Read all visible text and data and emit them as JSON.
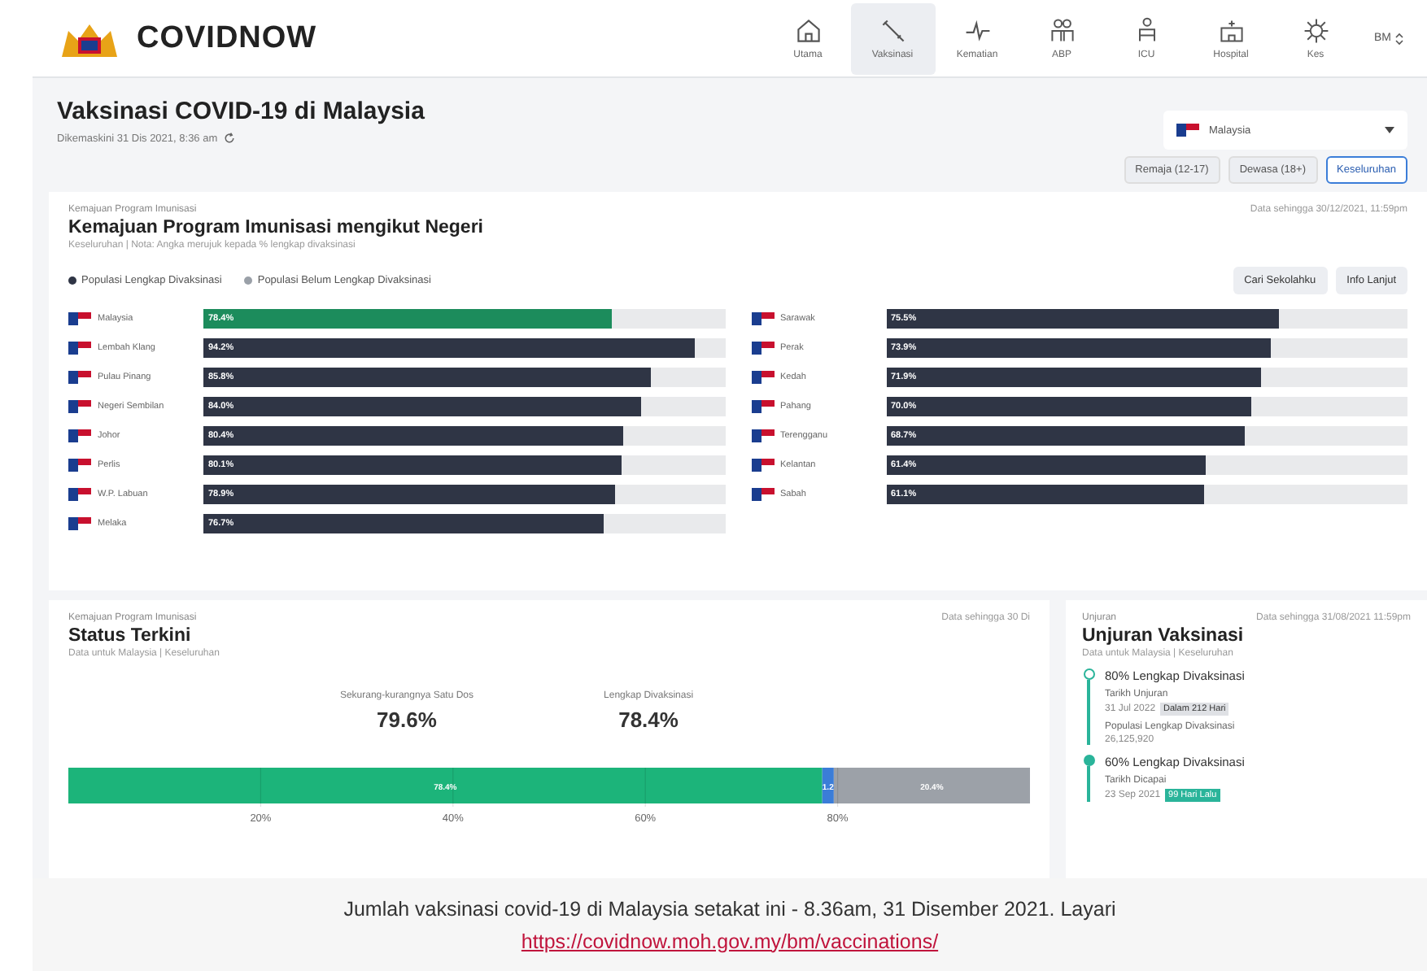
{
  "header": {
    "brand": "COVIDNOW",
    "nav": [
      {
        "label": "Utama",
        "selected": false
      },
      {
        "label": "Vaksinasi",
        "selected": true
      },
      {
        "label": "Kematian",
        "selected": false
      },
      {
        "label": "ABP",
        "selected": false
      },
      {
        "label": "ICU",
        "selected": false
      },
      {
        "label": "Hospital",
        "selected": false
      },
      {
        "label": "Kes",
        "selected": false
      }
    ],
    "language": "BM"
  },
  "page": {
    "title": "Vaksinasi COVID-19 di Malaysia",
    "updated": "Dikemaskini 31 Dis 2021, 8:36 am",
    "region": "Malaysia",
    "tabs": [
      {
        "label": "Remaja (12-17)",
        "selected": false
      },
      {
        "label": "Dewasa (18+)",
        "selected": false
      },
      {
        "label": "Keseluruhan",
        "selected": true
      }
    ]
  },
  "states_panel": {
    "eyebrow": "Kemajuan Program Imunisasi",
    "title": "Kemajuan Program Imunisasi mengikut Negeri",
    "subtitle": "Keseluruhan | Nota: Angka merujuk kepada % lengkap divaksinasi",
    "timestamp": "Data sehingga 30/12/2021, 11:59pm",
    "legend": [
      {
        "label": "Populasi Lengkap Divaksinasi",
        "color": "#2f3545"
      },
      {
        "label": "Populasi Belum Lengkap Divaksinasi",
        "color": "#9aa0a8"
      }
    ],
    "buttons": [
      "Cari Sekolahku",
      "Info Lanjut"
    ],
    "columns": [
      [
        {
          "name": "Malaysia",
          "kind": "national",
          "level": 0.784,
          "reading": "78.4%"
        },
        {
          "name": "Lembah Klang",
          "kind": "state",
          "level": 0.942,
          "reading": "94.2%"
        },
        {
          "name": "Pulau Pinang",
          "kind": "state",
          "level": 0.858,
          "reading": "85.8%"
        },
        {
          "name": "Negeri Sembilan",
          "kind": "state",
          "level": 0.84,
          "reading": "84.0%"
        },
        {
          "name": "Johor",
          "kind": "state",
          "level": 0.804,
          "reading": "80.4%"
        },
        {
          "name": "Perlis",
          "kind": "state",
          "level": 0.801,
          "reading": "80.1%"
        },
        {
          "name": "W.P. Labuan",
          "kind": "state",
          "level": 0.789,
          "reading": "78.9%"
        },
        {
          "name": "Melaka",
          "kind": "state",
          "level": 0.767,
          "reading": "76.7%"
        }
      ],
      [
        {
          "name": "Sarawak",
          "kind": "state",
          "level": 0.755,
          "reading": "75.5%"
        },
        {
          "name": "Perak",
          "kind": "state",
          "level": 0.739,
          "reading": "73.9%"
        },
        {
          "name": "Kedah",
          "kind": "state",
          "level": 0.719,
          "reading": "71.9%"
        },
        {
          "name": "Pahang",
          "kind": "state",
          "level": 0.7,
          "reading": "70.0%"
        },
        {
          "name": "Terengganu",
          "kind": "state",
          "level": 0.687,
          "reading": "68.7%"
        },
        {
          "name": "Kelantan",
          "kind": "state",
          "level": 0.614,
          "reading": "61.4%"
        },
        {
          "name": "Sabah",
          "kind": "state",
          "level": 0.611,
          "reading": "61.1%"
        }
      ]
    ]
  },
  "status_panel": {
    "eyebrow": "Kemajuan Program Imunisasi",
    "title": "Status Terkini",
    "subtitle": "Data untuk Malaysia | Keseluruhan",
    "timestamp": "Data sehingga 30 Di",
    "stats": [
      {
        "label": "Sekurang-kurangnya Satu Dos",
        "value": "79.6%"
      },
      {
        "label": "Lengkap Divaksinasi",
        "value": "78.4%"
      }
    ],
    "chart_data": {
      "type": "bar",
      "orientation": "horizontal",
      "stacked": true,
      "series": [
        {
          "color": "#1cb47a",
          "values": [
            78.4
          ]
        },
        {
          "color": "#3b7dd8",
          "values": [
            1.2
          ]
        },
        {
          "color": "#9ca1a8",
          "values": [
            20.4
          ]
        }
      ],
      "value_labels": [
        "78.4%",
        "1.2",
        "20.4%"
      ],
      "grid": true,
      "xlim": [
        0,
        100
      ],
      "xticks": [
        {
          "value": 20,
          "label": "20%"
        },
        {
          "value": 40,
          "label": "40%"
        },
        {
          "value": 60,
          "label": "60%"
        },
        {
          "value": 80,
          "label": "80%"
        }
      ]
    }
  },
  "projection_panel": {
    "eyebrow": "Unjuran",
    "title": "Unjuran Vaksinasi",
    "subtitle": "Data untuk Malaysia | Keseluruhan",
    "timestamp": "Data sehingga 31/08/2021 11:59pm",
    "milestones": [
      {
        "title": "80% Lengkap Divaksinasi",
        "reached": false,
        "date_label": "Tarikh Unjuran",
        "date": "31 Jul 2022",
        "badge": "Dalam 212 Hari",
        "extra_label": "Populasi Lengkap Divaksinasi",
        "extra_value": "26,125,920"
      },
      {
        "title": "60% Lengkap Divaksinasi",
        "reached": true,
        "date_label": "Tarikh Dicapai",
        "date": "23 Sep 2021",
        "badge": "99 Hari Lalu"
      }
    ]
  },
  "caption": {
    "text": "Jumlah vaksinasi covid-19 di Malaysia setakat ini - 8.36am, 31 Disember 2021. Layari",
    "link": "https://covidnow.moh.gov.my/bm/vaccinations/"
  }
}
